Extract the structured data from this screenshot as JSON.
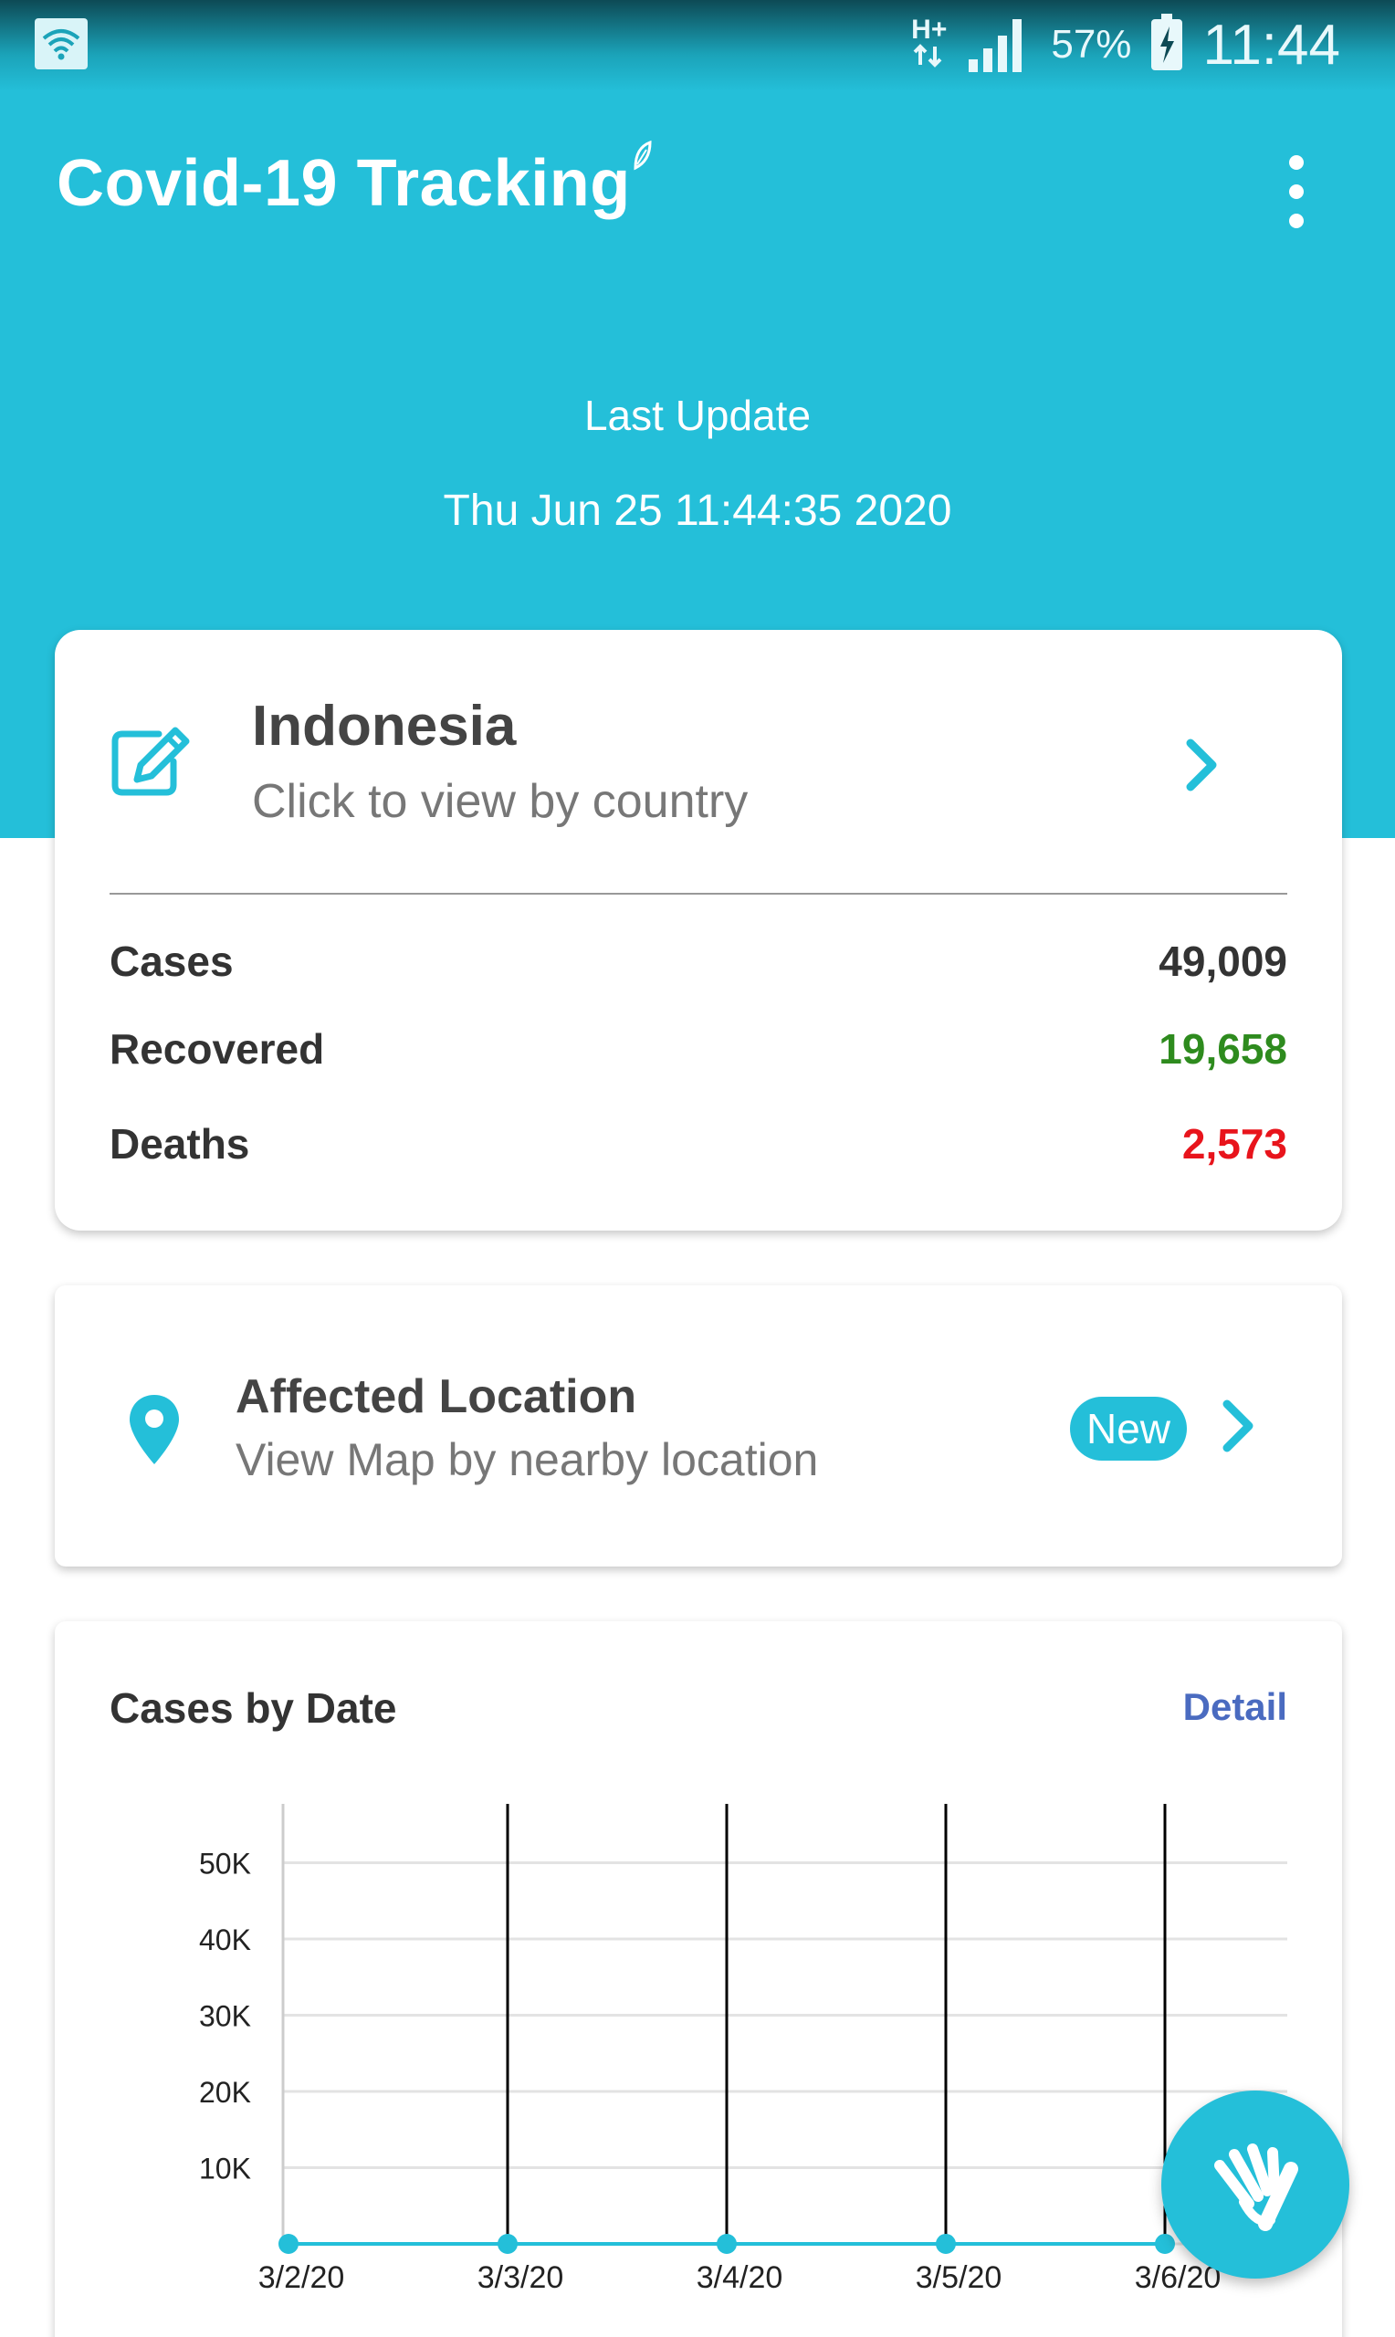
{
  "status_bar": {
    "network_type": "H+",
    "battery_percent": "57%",
    "time": "11:44"
  },
  "header": {
    "title": "Covid-19 Tracking",
    "last_update_label": "Last Update",
    "last_update_value": "Thu Jun 25 11:44:35 2020"
  },
  "country_card": {
    "country": "Indonesia",
    "subtitle": "Click to view by country",
    "stats": [
      {
        "label": "Cases",
        "value": "49,009",
        "color": "#333333"
      },
      {
        "label": "Recovered",
        "value": "19,658",
        "color": "#2e8b1e"
      },
      {
        "label": "Deaths",
        "value": "2,573",
        "color": "#e8141c"
      }
    ]
  },
  "location_card": {
    "title": "Affected Location",
    "subtitle": "View Map by nearby location",
    "badge": "New"
  },
  "chart_card": {
    "title": "Cases by Date",
    "detail_label": "Detail"
  },
  "colors": {
    "accent": "#24bfd9",
    "recovered": "#2e8b1e",
    "deaths": "#e8141c",
    "link": "#4a6bc0"
  },
  "chart_data": {
    "type": "line",
    "title": "Cases by Date",
    "x": [
      "3/2/20",
      "3/3/20",
      "3/4/20",
      "3/5/20",
      "3/6/20"
    ],
    "series": [
      {
        "values": [
          2,
          2,
          2,
          4,
          4
        ]
      }
    ],
    "yticks": [
      "10K",
      "20K",
      "30K",
      "40K",
      "50K"
    ],
    "ylim": [
      0,
      55000
    ],
    "grid": true
  }
}
